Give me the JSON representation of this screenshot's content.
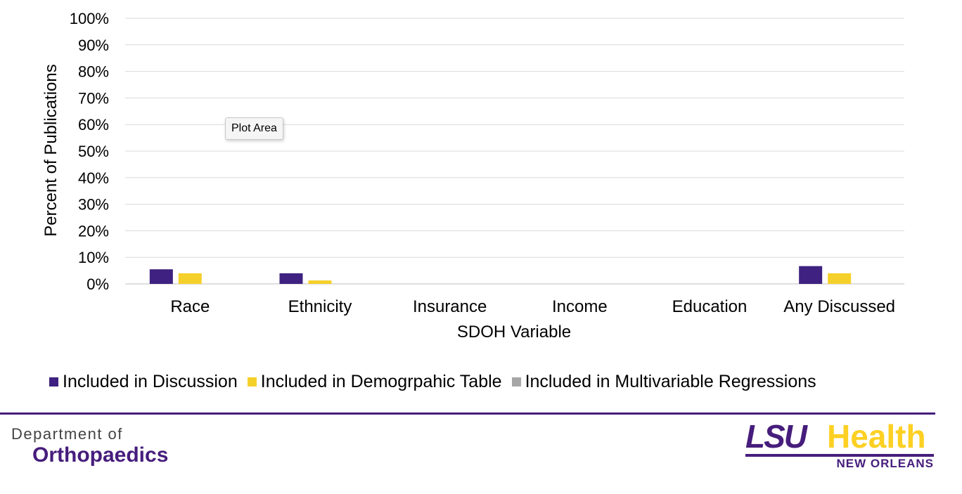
{
  "chart_data": {
    "type": "bar",
    "categories": [
      "Race",
      "Ethnicity",
      "Insurance",
      "Income",
      "Education",
      "Any Discussed"
    ],
    "series": [
      {
        "name": "Included in Discussion",
        "color": "#3e2180",
        "values": [
          5.5,
          4,
          0,
          0,
          0,
          6.7
        ]
      },
      {
        "name": "Included in Demogrpahic Table",
        "color": "#f6d02a",
        "values": [
          4,
          1.3,
          0,
          0,
          0,
          4
        ]
      },
      {
        "name": "Included in Multivariable Regressions",
        "color": "#a6a6a6",
        "values": [
          0,
          0,
          0,
          0,
          0,
          0
        ]
      }
    ],
    "y_ticks": [
      "0%",
      "10%",
      "20%",
      "30%",
      "40%",
      "50%",
      "60%",
      "70%",
      "80%",
      "90%",
      "100%"
    ],
    "xlabel": "SDOH Variable",
    "ylabel": "Percent of Publications",
    "ylim": [
      0,
      100
    ],
    "grid": true,
    "legend": "bottom"
  },
  "tooltip": {
    "text": "Plot Area"
  },
  "footer": {
    "dept_top": "Department of",
    "dept_bottom": "Orthopaedics",
    "logo_lsu": "LSU",
    "logo_health": "Health",
    "logo_sub": "NEW ORLEANS",
    "colors": {
      "purple": "#461d7c",
      "gold": "#fdd023",
      "divider": "#461d7c"
    }
  }
}
